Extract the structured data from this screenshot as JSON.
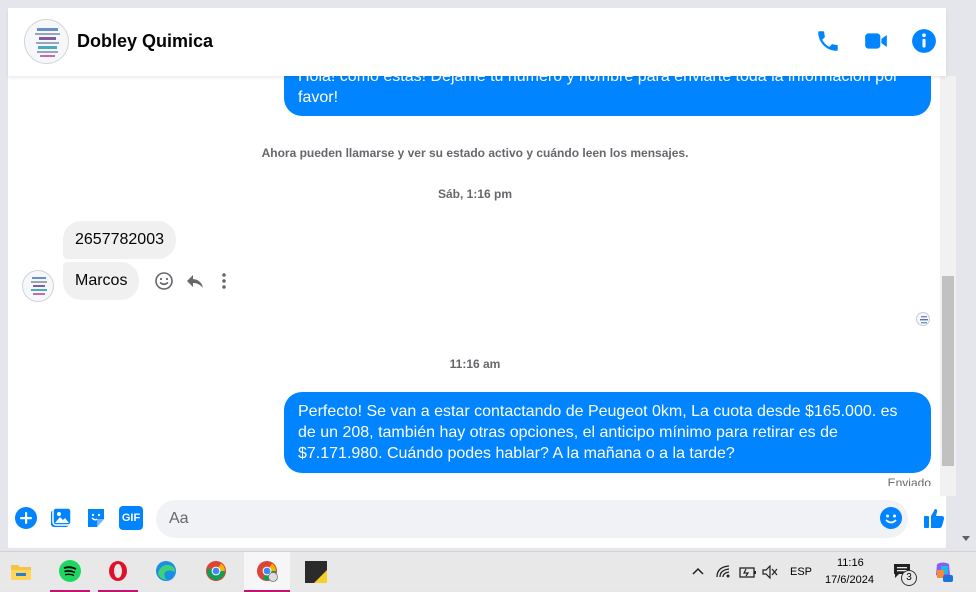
{
  "contact": {
    "name": "Dobley Quimica",
    "avatar_icon": "company-logo-avatar"
  },
  "header_actions": [
    {
      "name": "phone-call-icon",
      "color": "#0084ff"
    },
    {
      "name": "video-call-icon",
      "color": "#0084ff"
    },
    {
      "name": "info-icon",
      "color": "#0084ff"
    }
  ],
  "messages": {
    "top_partial": "Hola! como estas! Dejame tu numero y nombre para enviarte toda la informacion por favor!",
    "system_notice": "Ahora pueden llamarse y ver su estado activo y cuándo leen los mensajes.",
    "timestamp_1": "Sáb, 1:16 pm",
    "incoming_1": "2657782003",
    "incoming_2": "Marcos",
    "timestamp_2": "11:16 am",
    "outgoing_last": "Perfecto!  Se van a estar contactando de Peugeot 0km, La cuota desde $165.000. es de un 208, también hay otras opciones, el anticipo mínimo para retirar es de $7.171.980. Cuándo podes hablar? A la mañana o a la tarde?",
    "status": "Enviado"
  },
  "composer": {
    "placeholder": "Aa",
    "value": "",
    "gif_label": "GIF"
  },
  "colors": {
    "accent": "#0084ff",
    "incoming_bubble": "#f0f0f0",
    "muted_text": "#65676b"
  },
  "taskbar": {
    "apps": [
      "file-explorer",
      "spotify",
      "opera",
      "edge",
      "chrome",
      "chrome-profile",
      "sticky-app"
    ],
    "language": "ESP",
    "time": "11:16",
    "date": "17/6/2024",
    "notification_count": "3"
  }
}
